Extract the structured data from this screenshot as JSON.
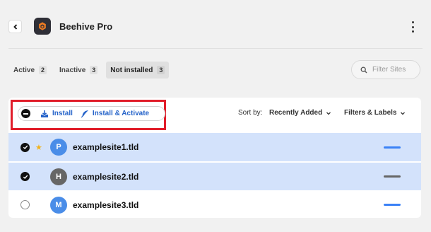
{
  "header": {
    "back_icon": "chevron-left-icon",
    "app_icon": "beehive-logo-icon",
    "title": "Beehive Pro",
    "menu_icon": "kebab-menu-icon"
  },
  "tabs": [
    {
      "label": "Active",
      "count": "2",
      "active": false
    },
    {
      "label": "Inactive",
      "count": "3",
      "active": false
    },
    {
      "label": "Not installed",
      "count": "3",
      "active": true
    }
  ],
  "filter": {
    "placeholder": "Filter Sites",
    "icon": "search-icon"
  },
  "bulk": {
    "select_state": "partial",
    "install_label": "Install",
    "install_icon": "install-download-icon",
    "install_activate_label": "Install & Activate",
    "install_activate_icon": "feather-icon"
  },
  "sort": {
    "label": "Sort by:",
    "value": "Recently Added"
  },
  "filters_labels": "Filters & Labels",
  "rows": [
    {
      "name": "examplesite1.tld",
      "initial": "P",
      "checked": true,
      "starred": true,
      "avatar_color": "#4a8de8",
      "status_color": "#3b82f6"
    },
    {
      "name": "examplesite2.tld",
      "initial": "H",
      "checked": true,
      "starred": false,
      "avatar_color": "#666666",
      "status_color": "#666666"
    },
    {
      "name": "examplesite3.tld",
      "initial": "M",
      "checked": false,
      "starred": false,
      "avatar_color": "#4a8de8",
      "status_color": "#3b82f6"
    }
  ],
  "colors": {
    "accent": "#2563c9",
    "highlight": "#e11d2a",
    "selected_row": "#d3e2fb",
    "star": "#f2b21b"
  }
}
